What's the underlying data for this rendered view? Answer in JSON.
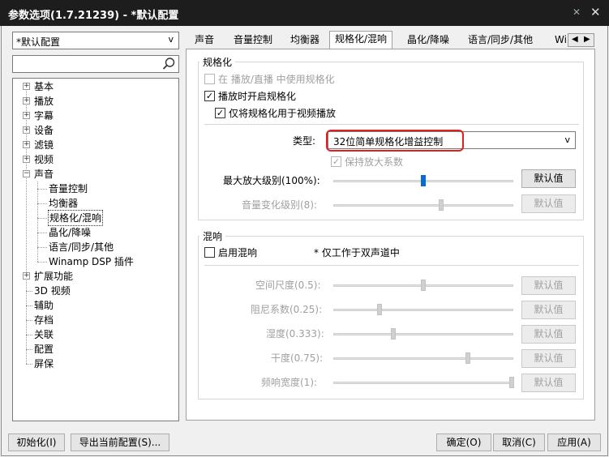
{
  "window": {
    "title": "参数选项(1.7.21239) - *默认配置",
    "pin_icon": "pin-icon",
    "close_icon": "close-icon"
  },
  "sidebar": {
    "profile_selected": "*默认配置",
    "search": {
      "value": "",
      "placeholder": ""
    },
    "tree": [
      {
        "label": "基本",
        "expandable": true
      },
      {
        "label": "播放",
        "expandable": true
      },
      {
        "label": "字幕",
        "expandable": true
      },
      {
        "label": "设备",
        "expandable": true
      },
      {
        "label": "滤镜",
        "expandable": true
      },
      {
        "label": "视频",
        "expandable": true
      },
      {
        "label": "声音",
        "expandable": true,
        "expanded": true
      },
      {
        "label": "音量控制",
        "child": true
      },
      {
        "label": "均衡器",
        "child": true
      },
      {
        "label": "规格化/混响",
        "child": true,
        "selected": true
      },
      {
        "label": "晶化/降噪",
        "child": true
      },
      {
        "label": "语言/同步/其他",
        "child": true
      },
      {
        "label": "Winamp DSP 插件",
        "child": true
      },
      {
        "label": "扩展功能",
        "expandable": true
      },
      {
        "label": "3D 视频"
      },
      {
        "label": "辅助"
      },
      {
        "label": "存档"
      },
      {
        "label": "关联"
      },
      {
        "label": "配置"
      },
      {
        "label": "屏保"
      }
    ]
  },
  "tabs": [
    "声音",
    "音量控制",
    "均衡器",
    "规格化/混响",
    "晶化/降噪",
    "语言/同步/其他",
    "Wi"
  ],
  "active_tab": "规格化/混响",
  "normalize": {
    "group_title": "规格化",
    "use_in_broadcast": {
      "label": "在 播放/直播 中使用规格化",
      "checked": false,
      "enabled": false
    },
    "enable_on_play": {
      "label": "播放时开启规格化",
      "checked": true,
      "enabled": true
    },
    "video_only": {
      "label": "仅将规格化用于视频播放",
      "checked": true,
      "enabled": true
    },
    "type_label": "类型:",
    "type_value": "32位简单规格化增益控制",
    "keep_factor": {
      "label": "保持放大系数",
      "checked": true,
      "enabled": false
    },
    "max_level": {
      "label": "最大放大级别(100%):",
      "value": 0.5,
      "enabled": true
    },
    "volume_change": {
      "label": "音量变化级别(8):",
      "value": 0.6,
      "enabled": false
    },
    "default_label": "默认值"
  },
  "reverb": {
    "group_title": "混响",
    "enable": {
      "label": "启用混响",
      "checked": false,
      "enabled": true
    },
    "note": "* 仅工作于双声道中",
    "sliders": [
      {
        "label": "空间尺度(0.5):",
        "value": 0.5
      },
      {
        "label": "阻尼系数(0.25):",
        "value": 0.25
      },
      {
        "label": "湿度(0.333):",
        "value": 0.33
      },
      {
        "label": "干度(0.75):",
        "value": 0.75
      },
      {
        "label": "频响宽度(1):",
        "value": 1.0
      }
    ],
    "default_label": "默认值"
  },
  "footer": {
    "reset": "初始化(I)",
    "export": "导出当前配置(S)...",
    "ok": "确定(O)",
    "cancel": "取消(C)",
    "apply": "应用(A)"
  }
}
